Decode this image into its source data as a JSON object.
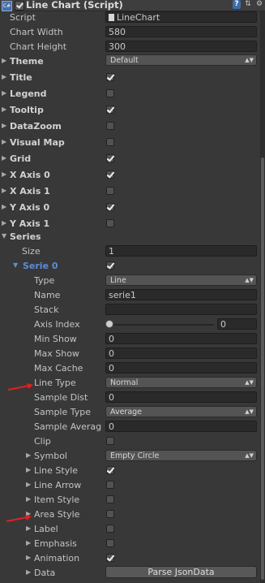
{
  "header": {
    "title": "Line Chart (Script)",
    "tools": [
      "help-icon",
      "preset-icon",
      "gear-icon"
    ]
  },
  "script": {
    "label": "Script",
    "value": "LineChart"
  },
  "chart_width": {
    "label": "Chart Width",
    "value": "580"
  },
  "chart_height": {
    "label": "Chart Height",
    "value": "300"
  },
  "theme": {
    "label": "Theme",
    "value": "Default"
  },
  "sections": [
    {
      "label": "Title",
      "checked": true
    },
    {
      "label": "Legend",
      "checked": false
    },
    {
      "label": "Tooltip",
      "checked": true
    },
    {
      "label": "DataZoom",
      "checked": false
    },
    {
      "label": "Visual Map",
      "checked": false
    },
    {
      "label": "Grid",
      "checked": true
    },
    {
      "label": "X Axis 0",
      "checked": true
    },
    {
      "label": "X Axis 1",
      "checked": false
    },
    {
      "label": "Y Axis 0",
      "checked": true
    },
    {
      "label": "Y Axis 1",
      "checked": false
    }
  ],
  "series": {
    "label": "Series",
    "size_label": "Size",
    "size_value": "1"
  },
  "serie0": {
    "label": "Serie 0",
    "type": {
      "label": "Type",
      "value": "Line"
    },
    "name": {
      "label": "Name",
      "value": "serie1"
    },
    "stack": {
      "label": "Stack",
      "value": ""
    },
    "axis_index": {
      "label": "Axis Index",
      "value": "0"
    },
    "min_show": {
      "label": "Min Show",
      "value": "0"
    },
    "max_show": {
      "label": "Max Show",
      "value": "0"
    },
    "max_cache": {
      "label": "Max Cache",
      "value": "0"
    },
    "line_type": {
      "label": "Line Type",
      "value": "Normal"
    },
    "sample_dist": {
      "label": "Sample Dist",
      "value": "0"
    },
    "sample_type": {
      "label": "Sample Type",
      "value": "Average"
    },
    "sample_average": {
      "label": "Sample Averag",
      "value": "0"
    },
    "clip": {
      "label": "Clip"
    },
    "symbol": {
      "label": "Symbol",
      "value": "Empty Circle"
    },
    "line_style": {
      "label": "Line Style"
    },
    "line_arrow": {
      "label": "Line Arrow"
    },
    "item_style": {
      "label": "Item Style"
    },
    "area_style": {
      "label": "Area Style"
    },
    "label_item": {
      "label": "Label"
    },
    "emphasis": {
      "label": "Emphasis"
    },
    "animation": {
      "label": "Animation"
    },
    "data": {
      "label": "Data",
      "button": "Parse JsonData"
    }
  },
  "colors": {
    "accent": "#5b8ddb",
    "annotation": "#e02020"
  }
}
